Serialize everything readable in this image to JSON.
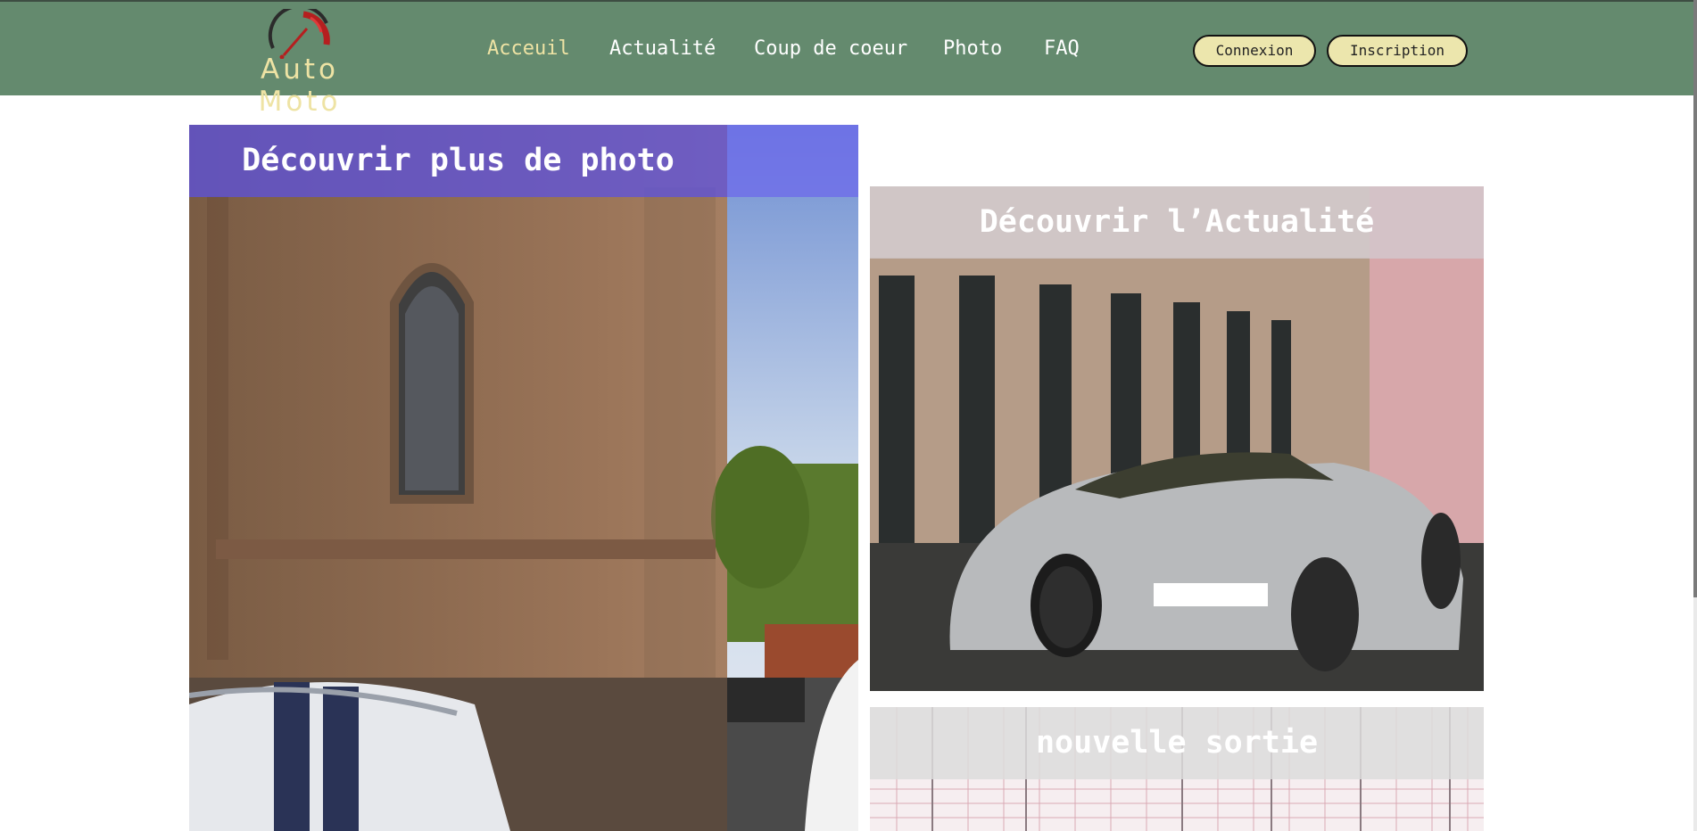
{
  "brand": {
    "name": "Auto Moto"
  },
  "nav": {
    "items": [
      {
        "label": "Acceuil",
        "active": true
      },
      {
        "label": "Actualité",
        "active": false
      },
      {
        "label": "Coup de coeur",
        "active": false
      },
      {
        "label": "Photo",
        "active": false
      },
      {
        "label": "FAQ",
        "active": false
      }
    ]
  },
  "auth": {
    "login_label": "Connexion",
    "signup_label": "Inscription"
  },
  "cards": {
    "photo": {
      "title": "Découvrir plus de photo",
      "image": "church-street-with-white-mustang-photo"
    },
    "news": {
      "title": "Découvrir l’Actualité",
      "image": "silver-bugatti-veyron-photo"
    },
    "release": {
      "title": "nouvelle sortie",
      "image": "grid-pattern-photo"
    }
  },
  "colors": {
    "header_bg": "#648a6e",
    "accent": "#eee3a4",
    "button_bg": "#ece6ad",
    "photo_banner": "#7a76e8",
    "news_banner": "#c8c2c6",
    "release_banner": "#dcdcdc"
  }
}
